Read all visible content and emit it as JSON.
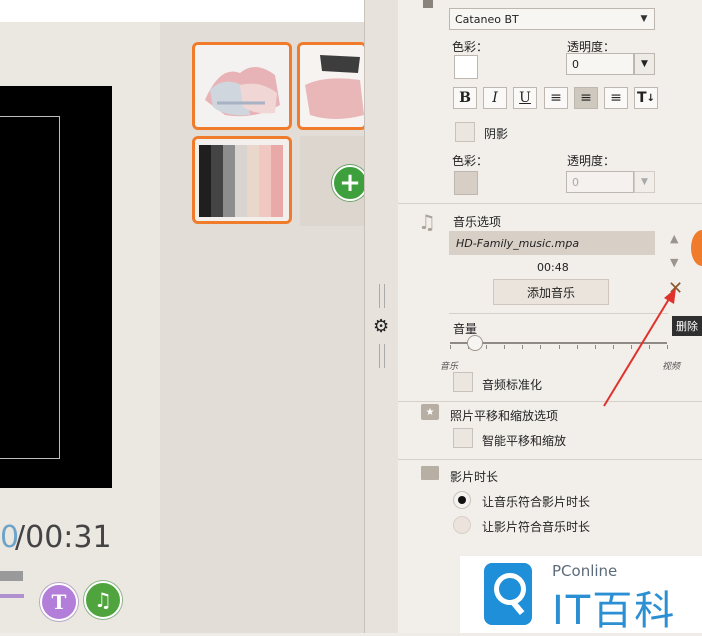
{
  "preview": {
    "time_current": "0",
    "time_total": "/00:31"
  },
  "text_panel": {
    "font_name": "Cataneo BT",
    "color_label": "色彩：",
    "opacity_label": "透明度：",
    "opacity_value": "0",
    "format_buttons": [
      "B",
      "I",
      "U",
      "≡",
      "≡",
      "≡",
      "T"
    ],
    "shadow_label": "阴影",
    "shadow_color_label": "色彩：",
    "shadow_opacity_label": "透明度：",
    "shadow_opacity_value": "0"
  },
  "music": {
    "section_title": "音乐选项",
    "file_name": "HD-Family_music.mpa",
    "duration": "00:48",
    "add_button": "添加音乐",
    "delete_tooltip": "删除",
    "volume_label": "音量",
    "slider_left_label": "音乐",
    "slider_right_label": "视频",
    "slider_value": 0.03,
    "normalize_label": "音频标准化"
  },
  "pan_zoom": {
    "section_title": "照片平移和缩放选项",
    "smart_label": "智能平移和缩放"
  },
  "duration": {
    "section_title": "影片时长",
    "option1": "让音乐符合影片时长",
    "option2": "让影片符合音乐时长",
    "selected": 0
  },
  "watermark": {
    "brand": "PConline",
    "text": "IT百科"
  },
  "colors": {
    "accent_orange": "#f07b2a",
    "green": "#3ea03c",
    "purple": "#b27ed9",
    "arrow_red": "#e0322c"
  }
}
